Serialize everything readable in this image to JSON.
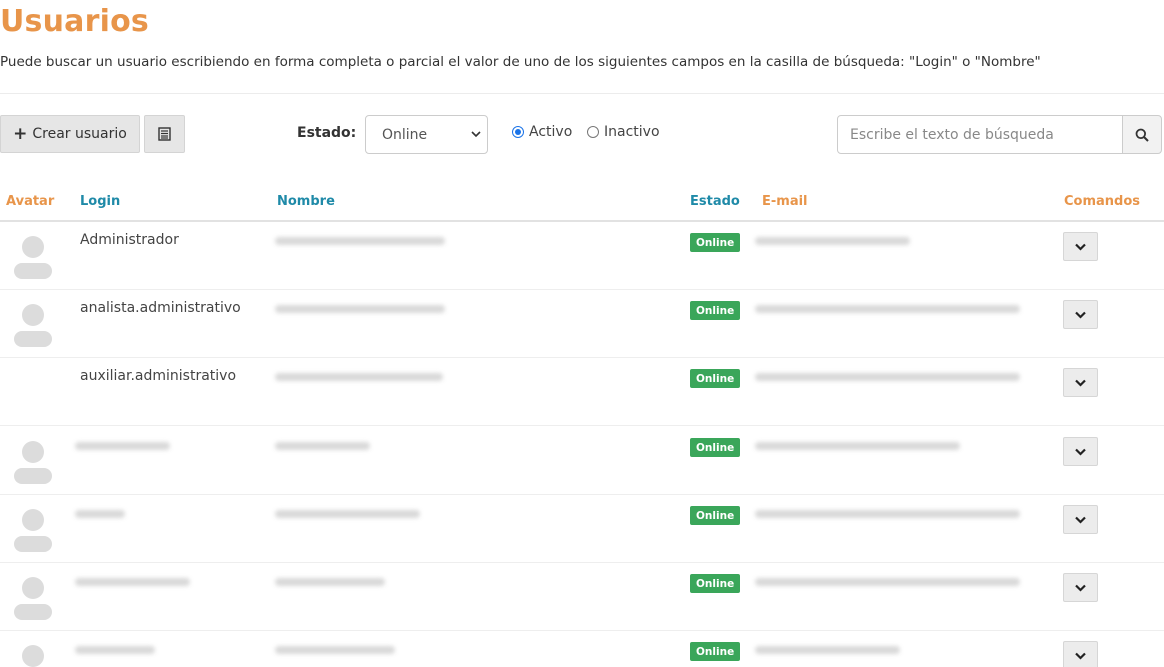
{
  "page": {
    "title": "Usuarios",
    "description": "Puede buscar un usuario escribiendo en forma completa o parcial el valor de uno de los siguientes campos en la casilla de búsqueda: \"Login\" o \"Nombre\""
  },
  "toolbar": {
    "create_label": "Crear usuario",
    "estado_label": "Estado:",
    "estado_selected": "Online",
    "radio_activo": "Activo",
    "radio_inactivo": "Inactivo",
    "radio_selected": "Activo",
    "search_placeholder": "Escribe el texto de búsqueda"
  },
  "table": {
    "headers": {
      "avatar": "Avatar",
      "login": "Login",
      "nombre": "Nombre",
      "estado": "Estado",
      "email": "E-mail",
      "comandos": "Comandos"
    },
    "rows": [
      {
        "login": "Administrador",
        "estado": "Online"
      },
      {
        "login": "analista.administrativo",
        "estado": "Online"
      },
      {
        "login": "auxiliar.administrativo",
        "estado": "Online"
      },
      {
        "login": "",
        "estado": "Online"
      },
      {
        "login": "",
        "estado": "Online"
      },
      {
        "login": "",
        "estado": "Online"
      },
      {
        "login": "",
        "estado": "Online"
      }
    ]
  },
  "colors": {
    "accent_orange": "#e8954a",
    "header_teal": "#1f8aa8",
    "status_green": "#3aa65a"
  },
  "icons": {
    "create": "plus-icon",
    "list": "list-icon",
    "search": "search-icon",
    "command": "chevron-down-icon",
    "avatar": "user-avatar-icon"
  }
}
